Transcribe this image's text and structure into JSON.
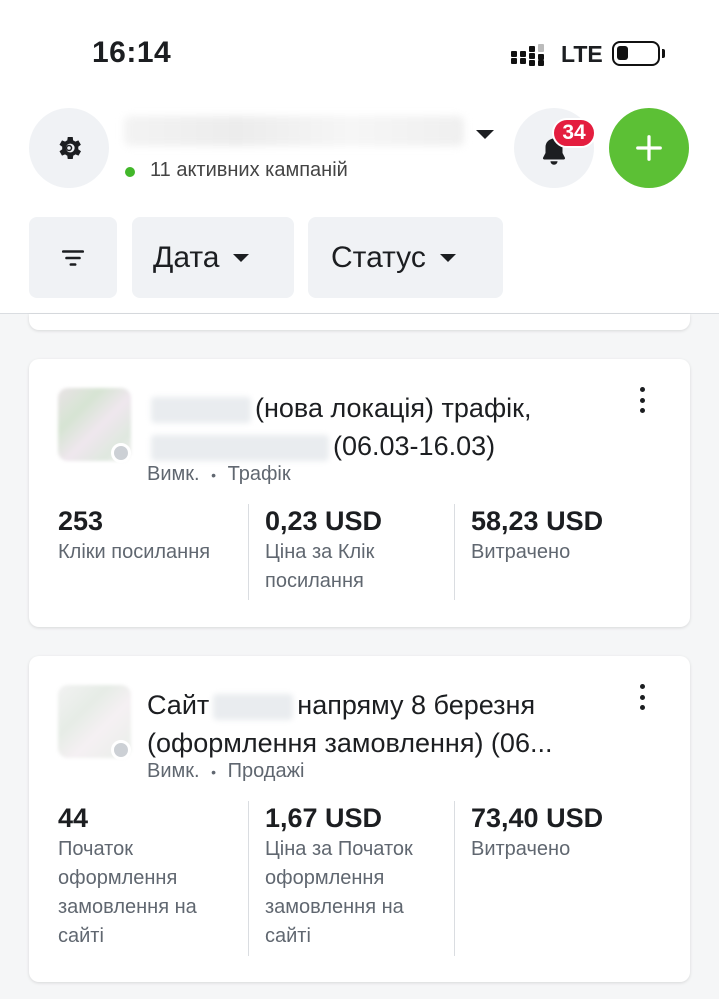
{
  "status_bar": {
    "time": "16:14",
    "network": "LTE"
  },
  "header": {
    "active_campaigns": "11 активних кампаній",
    "notification_count": "34",
    "colors": {
      "add": "#5cc035",
      "badge": "#e41e3f",
      "active_dot": "#42b72a"
    }
  },
  "filters": {
    "date_label": "Дата",
    "status_label": "Статус"
  },
  "campaigns": [
    {
      "title_visible_1": "(нова локація) трафік,",
      "title_visible_2": "(06.03-16.03)",
      "status": "Вимк.",
      "separator": "•",
      "objective": "Трафік",
      "metrics": [
        {
          "value": "253",
          "label": "Кліки посилання"
        },
        {
          "value": "0,23 USD",
          "label": "Ціна за Клік посилання"
        },
        {
          "value": "58,23 USD",
          "label": "Витрачено"
        }
      ]
    },
    {
      "title_visible_1": "Сайт",
      "title_visible_2": "напряму 8 березня",
      "title_visible_3": "(оформлення замовлення) (06...",
      "status": "Вимк.",
      "separator": "•",
      "objective": "Продажі",
      "metrics": [
        {
          "value": "44",
          "label": "Початок оформлення замовлення на сайті"
        },
        {
          "value": "1,67 USD",
          "label": "Ціна за Початок оформлення замовлення на сайті"
        },
        {
          "value": "73,40 USD",
          "label": "Витрачено"
        }
      ]
    }
  ],
  "icons": [
    "settings-icon",
    "bell-icon",
    "plus-icon",
    "filter-sort-icon",
    "more-vertical-icon",
    "signal-icon",
    "battery-icon"
  ]
}
